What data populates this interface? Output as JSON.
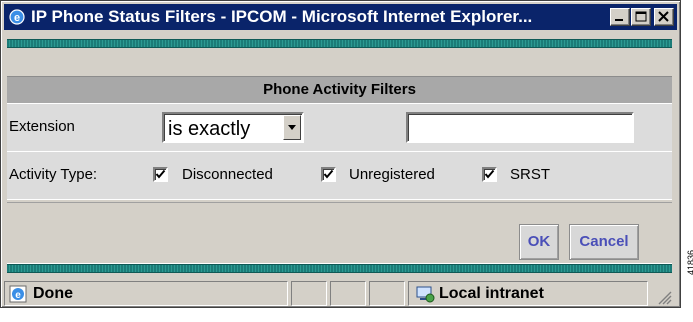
{
  "window": {
    "title": "IP Phone Status Filters - IPCOM - Microsoft Internet Explorer..."
  },
  "titlebar_buttons": [
    {
      "name": "minimize-button",
      "icon": "minimize-icon"
    },
    {
      "name": "maximize-button",
      "icon": "maximize-icon"
    },
    {
      "name": "close-button",
      "icon": "close-icon"
    }
  ],
  "section": {
    "title": "Phone Activity Filters"
  },
  "extension": {
    "label": "Extension",
    "operator_value": "is exactly",
    "text_value": ""
  },
  "activity": {
    "label": "Activity Type:",
    "options": [
      {
        "label": "Disconnected",
        "checked": true
      },
      {
        "label": "Unregistered",
        "checked": true
      },
      {
        "label": "SRST",
        "checked": true
      }
    ]
  },
  "buttons": {
    "ok": "OK",
    "cancel": "Cancel"
  },
  "status": {
    "text": "Done",
    "zone": "Local intranet"
  },
  "side_number": "41836",
  "colors": {
    "titlebar": "#0a246a",
    "teal_band": "#1c7c78",
    "header_bg": "#a8a8a8",
    "row_bg": "#dcdcdc",
    "button_text": "#4a4fb8"
  }
}
